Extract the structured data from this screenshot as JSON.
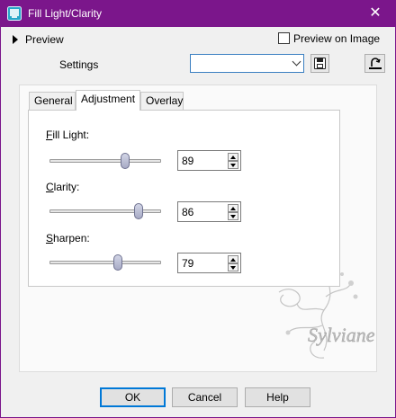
{
  "window": {
    "title": "Fill Light/Clarity",
    "close_glyph": "✕",
    "app_icon": "fill-light-app-icon",
    "accent_color": "#7b168b"
  },
  "preview": {
    "toggle_label": "Preview",
    "checkbox_label": "Preview on Image",
    "checkbox_checked": false
  },
  "settings": {
    "label": "Settings",
    "selected_value": ""
  },
  "tabs": [
    {
      "label": "General",
      "active": false
    },
    {
      "label": "Adjustment",
      "active": true
    },
    {
      "label": "Overlay",
      "active": false
    }
  ],
  "adjustment": {
    "fill_light": {
      "label_first": "F",
      "label_rest": "ill Light:",
      "value": "89",
      "slider_fraction": 0.68
    },
    "clarity": {
      "label_first": "C",
      "label_rest": "larity:",
      "value": "86",
      "slider_fraction": 0.8
    },
    "sharpen": {
      "label_first": "S",
      "label_rest": "harpen:",
      "value": "79",
      "slider_fraction": 0.61
    }
  },
  "watermark": {
    "text": "Sylviane"
  },
  "buttons": {
    "ok": "OK",
    "cancel": "Cancel",
    "help": "Help"
  }
}
